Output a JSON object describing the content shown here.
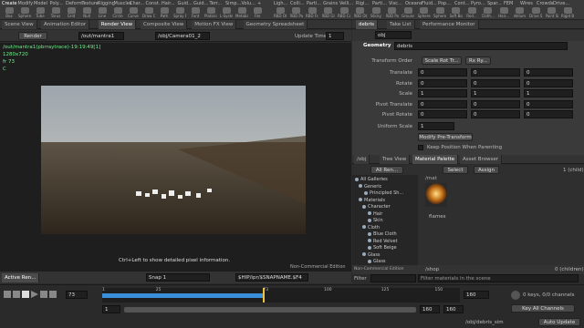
{
  "shelf": {
    "tabs": [
      "Create",
      "Modify",
      "Model",
      "Poly...",
      "Deform",
      "Texture",
      "Rigging",
      "Muscles",
      "Char...",
      "Const...",
      "Hair...",
      "Guid...",
      "Guid...",
      "Terr...",
      "Simp...",
      "Volu...",
      "+",
      "Ligh...",
      "Colli...",
      "Parti...",
      "Grains",
      "Velli...",
      "Rigi...",
      "Parti...",
      "Visc...",
      "Oceans",
      "Fluid...",
      "Pop...",
      "Cont...",
      "Pyro...",
      "Spar...",
      "FEM",
      "Wires",
      "Crowds",
      "Drive..."
    ],
    "tools": [
      "Box",
      "Sphere",
      "Tube",
      "Torus",
      "Grid",
      "Null",
      "Line",
      "Circle",
      "Curve",
      "Draw Curve",
      "Path",
      "Spray Paint",
      "Font",
      "Platonic Solids",
      "L-System",
      "Metaball",
      "File"
    ],
    "right_tools": [
      "RBD Object",
      "RBD Packed...",
      "RBD Fractured...",
      "RBD Glue...",
      "RBD Configure...",
      "RBD Object...",
      "Sticky",
      "RBD Paint",
      "Ground Plane",
      "Spheres Sphere",
      "Spheres Plane",
      "Soft Body",
      "Rod...",
      "Cloth...",
      "Hair...",
      "Vellum Brush",
      "Drive Sim",
      "Point Sims",
      "Rigid Ball"
    ]
  },
  "left": {
    "tabs": [
      "Scene View",
      "Animation Editor",
      "Render View",
      "Composite View",
      "Motion FX View",
      "Geometry Spreadsheet"
    ],
    "render_label": "Render",
    "camera_path": "/out/mantra1",
    "obj_path": "/obj/Camera01_2",
    "update_label": "Update Time",
    "update_value": "1",
    "info_lines": [
      "/out/mantra1(pbrraytrace)-19:19:49[1]",
      "1280x720",
      "fr 73",
      "C"
    ],
    "hint": "Ctrl+Left to show detailed pixel information.",
    "edition": "Non-Commercial Edition",
    "bottom_tab": "Active Ren...",
    "snap_label": "Snap 1",
    "hip_path": "$HIP/ipr/$SNAPNAME.$F4"
  },
  "right": {
    "top_tabs": [
      "debris",
      "Take List",
      "Performance Monitor"
    ],
    "path": "obj",
    "node_type": "Geometry",
    "node_name": "debris",
    "transform_order_label": "Transform Order",
    "transform_order_value": "Scale Rot Tr...",
    "rot_order_value": "Rx Ry...",
    "params": [
      {
        "label": "Translate",
        "v": [
          "0",
          "0",
          "0"
        ]
      },
      {
        "label": "Rotate",
        "v": [
          "0",
          "0",
          "0"
        ]
      },
      {
        "label": "Scale",
        "v": [
          "1",
          "1",
          "1"
        ]
      },
      {
        "label": "Pivot Translate",
        "v": [
          "0",
          "0",
          "0"
        ]
      },
      {
        "label": "Pivot Rotate",
        "v": [
          "0",
          "0",
          "0"
        ]
      }
    ],
    "uniform_scale_label": "Uniform Scale",
    "uniform_scale_value": "1",
    "modify_pre_transform": "Modify Pre-Transform",
    "keep_position": "Keep Position When Parenting"
  },
  "material": {
    "tabs": [
      "/obj",
      "Tree View",
      "Material Palette",
      "Asset Browser"
    ],
    "filter_all": "All Ren...",
    "select_label": "Select",
    "assign_label": "Assign",
    "count": "1 (child)",
    "mat_path": "/mat",
    "tree": [
      "All Galleries",
      "Generic",
      "Principled Sh...",
      "Materials",
      "Character",
      "Hair",
      "Skin",
      "Cloth",
      "Blue Cloth",
      "Red Velvet",
      "Soft Beige",
      "Glass",
      "Glass"
    ],
    "material_name": "flames",
    "shop_path": "/shop",
    "shop_count": "0 (children)",
    "filter_label": "Filter",
    "filter_placeholder": "Filter materials in the scene",
    "edition": "Non-Commercial Edition"
  },
  "timeline": {
    "current_frame": "73",
    "start": "1",
    "end": "160",
    "start2": "1",
    "end2": "160",
    "tick_labels": [
      "1",
      "25",
      "73",
      "100",
      "125",
      "150"
    ],
    "progress": 0.45,
    "keys_text": "0 keys, 0/0 channels",
    "key_all": "Key All Channels",
    "path": "/obj/debris_sim",
    "auto_update": "Auto Update"
  },
  "colors": {
    "accent": "#3a8fd9",
    "playhead": "#f0c040"
  }
}
